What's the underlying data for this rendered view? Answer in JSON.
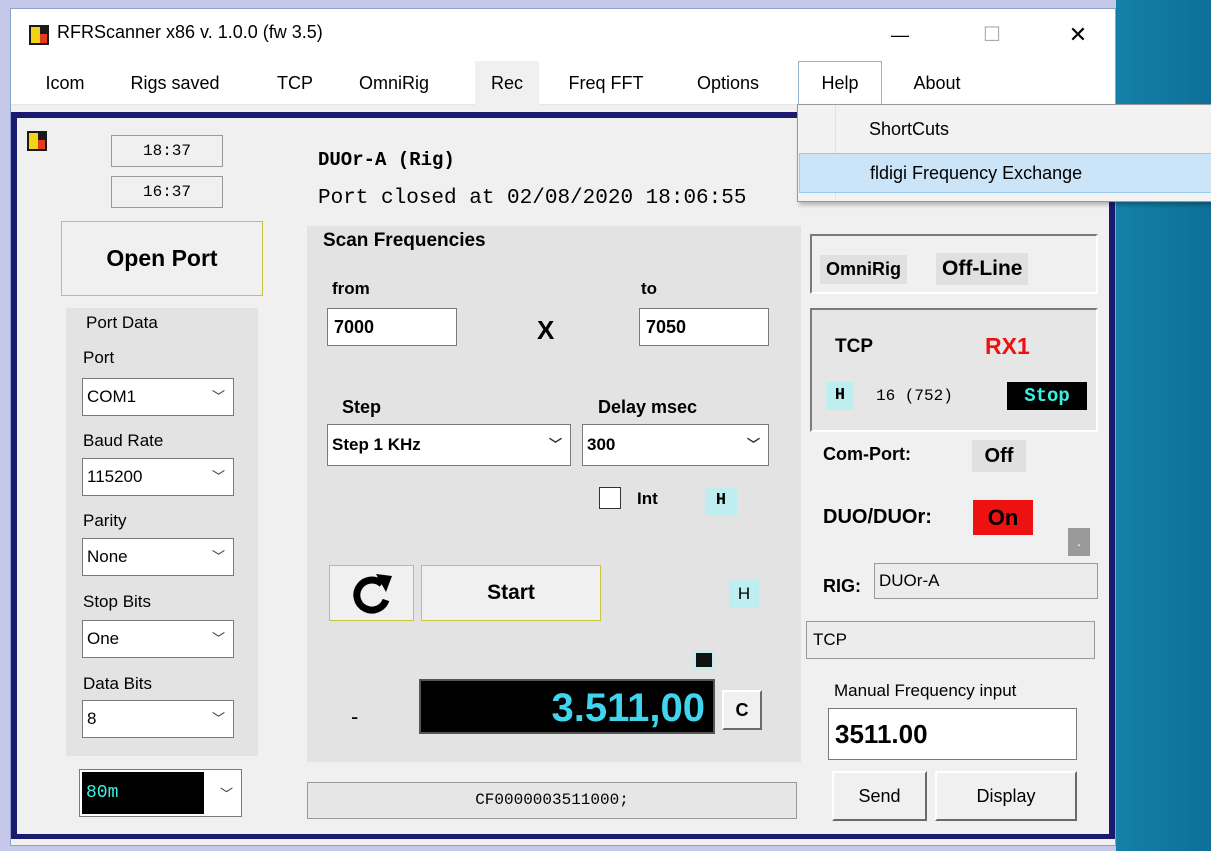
{
  "window": {
    "title": "RFRScanner  x86 v. 1.0.0  (fw 3.5)",
    "controls": {
      "minimize": "—",
      "maximize": "☐",
      "close": "✕"
    }
  },
  "menu": {
    "items": [
      "Icom",
      "Rigs saved",
      "TCP",
      "OmniRig",
      "Rec",
      "Freq FFT",
      "Options",
      "Help",
      "About"
    ]
  },
  "help_menu": {
    "items": [
      "ShortCuts",
      "fldigi Frequency Exchange"
    ]
  },
  "left": {
    "time1": "18:37",
    "time2": "16:37",
    "open_port": "Open Port",
    "port_data_title": "Port Data",
    "port_label": "Port",
    "port_value": "COM1",
    "baud_label": "Baud Rate",
    "baud_value": "115200",
    "parity_label": "Parity",
    "parity_value": "None",
    "stop_label": "Stop Bits",
    "stop_value": "One",
    "data_label": "Data Bits",
    "data_value": "8",
    "band_value": "80m"
  },
  "center": {
    "rig_name": "DUOr-A (Rig)",
    "port_status": "Port closed at 02/08/2020 18:06:55",
    "scan_title": "Scan Frequencies",
    "from_label": "from",
    "from_value": "7000",
    "x_label": "X",
    "to_label": "to",
    "to_value": "7050",
    "step_label": "Step",
    "step_value": "Step 1 KHz",
    "delay_label": "Delay  msec",
    "delay_value": "300",
    "int_label": "Int",
    "h1": "H",
    "start_label": "Start",
    "h2": "H",
    "dash": "-",
    "freq_display": "3.511,00",
    "c_button": "C",
    "cat_command": "CF0000003511000;"
  },
  "right": {
    "omnirig_label": "OmniRig",
    "omnirig_status": "Off-Line",
    "tcp_label": "TCP",
    "rx_label": "RX1",
    "h_badge": "H",
    "tcp_counter": "16 (752)",
    "stop_label": "Stop",
    "comport_label": "Com-Port:",
    "comport_value": "Off",
    "duo_label": "DUO/DUOr:",
    "duo_value": "On",
    "small_button": ".",
    "rig_label": "RIG:",
    "rig_value": "DUOr-A",
    "tcp_field": "TCP",
    "manual_label": "Manual Frequency input",
    "manual_value": "3511.00",
    "send_label": "Send",
    "display_label": "Display"
  }
}
